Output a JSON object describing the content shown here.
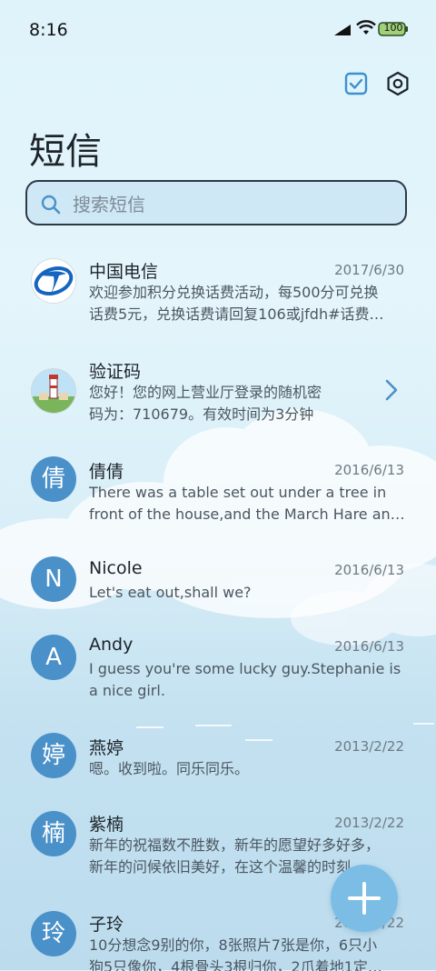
{
  "status_bar": {
    "time": "8:16",
    "battery": "100"
  },
  "header": {
    "title": "短信"
  },
  "search": {
    "placeholder": "搜索短信"
  },
  "messages": [
    {
      "name": "中国电信",
      "date": "2017/6/30",
      "lines": [
        "欢迎参加积分兑换话费活动，每500分可兑换",
        "话费5元，兑换话费请回复106或jfdh#话费…"
      ],
      "avatar_type": "logo"
    },
    {
      "name": "验证码",
      "date": "",
      "lines": [
        "您好！您的网上营业厅登录的随机密",
        "码为：710679。有效时间为3分钟"
      ],
      "avatar_type": "photo"
    },
    {
      "name": "倩倩",
      "date": "2016/6/13",
      "lines": [
        "There was a table set out under a tree in",
        "front of the house,and the March Hare an…"
      ],
      "avatar_letter": "倩"
    },
    {
      "name": "Nicole",
      "date": "2016/6/13",
      "lines": [
        "Let's eat out,shall we?"
      ],
      "avatar_letter": "N"
    },
    {
      "name": "Andy",
      "date": "2016/6/13",
      "lines": [
        "I guess you're some lucky guy.Stephanie is",
        "a nice girl."
      ],
      "avatar_letter": "A"
    },
    {
      "name": "燕婷",
      "date": "2013/2/22",
      "lines": [
        "嗯。收到啦。同乐同乐。"
      ],
      "avatar_letter": "婷"
    },
    {
      "name": "紫楠",
      "date": "2013/2/22",
      "lines": [
        "新年的祝福数不胜数，新年的愿望好多好多，",
        "新年的问候依旧美好，在这个温馨的时刻…"
      ],
      "avatar_letter": "楠"
    },
    {
      "name": "子玲",
      "date": "2013/2/22",
      "lines": [
        "10分想念9别的你，8张照片7张是你，6只小",
        "狗5只像你，4根骨头3根归你，2爪着地1定…"
      ],
      "avatar_letter": "玲"
    }
  ]
}
